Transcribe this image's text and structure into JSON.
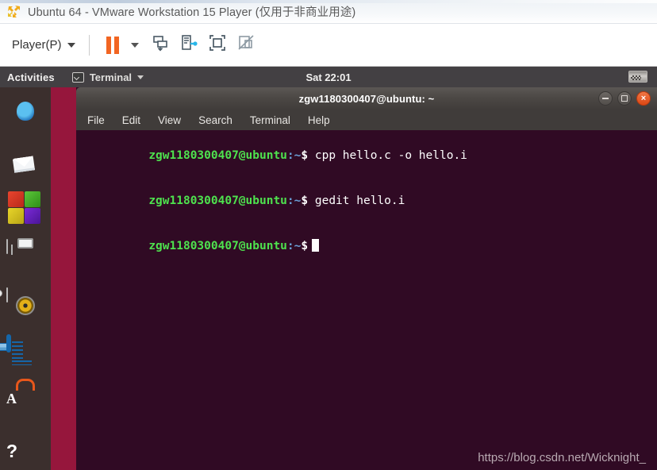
{
  "vmware": {
    "title": "Ubuntu 64  - VMware Workstation 15 Player (仅用于非商业用途)",
    "logo_icon": "vmware-logo-icon",
    "toolbar": {
      "player_menu_label": "Player(P)",
      "player_caret_icon": "chevron-down-icon",
      "pause_icon": "pause-icon",
      "pause_caret_icon": "chevron-down-icon",
      "snapshot_icon": "send-to-back-icon",
      "usb_icon": "usb-device-icon",
      "fullscreen_icon": "fullscreen-icon",
      "unity_icon": "unity-mode-disabled-icon"
    }
  },
  "ubuntu": {
    "topbar": {
      "activities": "Activities",
      "app_icon": "terminal-icon",
      "app_name": "Terminal",
      "app_caret_icon": "chevron-down-icon",
      "clock": "Sat 22:01",
      "keyboard_icon": "keyboard-layout-icon"
    },
    "dock": {
      "items": [
        {
          "name": "firefox",
          "label": "Firefox"
        },
        {
          "name": "thunderbird",
          "label": "Thunderbird Mail"
        },
        {
          "name": "cubes",
          "label": "Files (Nautilus) / Workspace"
        },
        {
          "name": "files",
          "label": "Files"
        },
        {
          "name": "rhythmbox",
          "label": "Rhythmbox"
        },
        {
          "name": "writer",
          "label": "LibreOffice Writer"
        },
        {
          "name": "software",
          "label": "Ubuntu Software"
        },
        {
          "name": "help",
          "label": "Help",
          "glyph": "?"
        }
      ]
    },
    "software_glyph": "A"
  },
  "terminal": {
    "window_title": "zgw1180300407@ubuntu: ~",
    "window_buttons": {
      "minimize": "minimize-icon",
      "maximize": "maximize-icon",
      "close": "close-icon"
    },
    "menus": [
      "File",
      "Edit",
      "View",
      "Search",
      "Terminal",
      "Help"
    ],
    "prompt": {
      "user_host": "zgw1180300407@ubuntu",
      "path": ":~",
      "symbol": "$"
    },
    "lines": [
      {
        "command": "cpp hello.c -o hello.i"
      },
      {
        "command": "gedit hello.i"
      },
      {
        "command": ""
      }
    ],
    "colors": {
      "background": "#300a24",
      "prompt_user": "#4ee24e",
      "prompt_path": "#6a9fd8",
      "text": "#ffffff"
    }
  },
  "watermark": "https://blog.csdn.net/Wicknight_"
}
